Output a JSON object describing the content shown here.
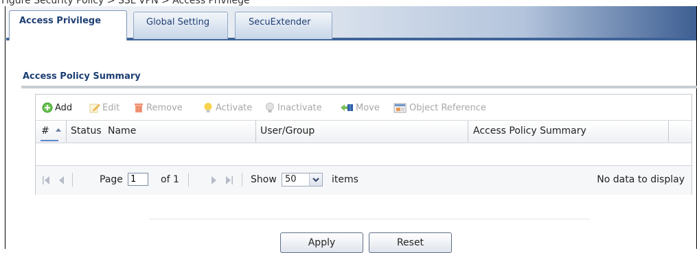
{
  "caption": {
    "text": "Figure Security Policy > SSL VPN > Access Privilege"
  },
  "tabs": [
    {
      "label": "Access Privilege",
      "active": true
    },
    {
      "label": "Global Setting",
      "active": false
    },
    {
      "label": "SecuExtender",
      "active": false
    }
  ],
  "section": {
    "title": "Access Policy Summary"
  },
  "toolbar": {
    "add": {
      "label": "Add",
      "icon": "add-icon",
      "enabled": true
    },
    "edit": {
      "label": "Edit",
      "icon": "edit-icon",
      "enabled": false
    },
    "remove": {
      "label": "Remove",
      "icon": "remove-icon",
      "enabled": false
    },
    "activate": {
      "label": "Activate",
      "icon": "lightbulb-on-icon",
      "enabled": false
    },
    "inactivate": {
      "label": "Inactivate",
      "icon": "lightbulb-off-icon",
      "enabled": false
    },
    "move": {
      "label": "Move",
      "icon": "move-icon",
      "enabled": false
    },
    "object_reference": {
      "label": "Object Reference",
      "icon": "object-reference-icon",
      "enabled": false
    }
  },
  "table": {
    "columns": [
      "#",
      "Status",
      "Name",
      "User/Group",
      "Access Policy Summary"
    ],
    "rows": []
  },
  "pager": {
    "page_label": "Page",
    "page_value": "1",
    "of_label": "of 1",
    "show_label": "Show",
    "show_value": "50",
    "items_label": "items",
    "status": "No data to display"
  },
  "buttons": {
    "apply": "Apply",
    "reset": "Reset"
  },
  "colors": {
    "tab_text": "#1f3f74",
    "section_title": "#1b3d73",
    "tab_bar_end": "#3e5f93"
  }
}
